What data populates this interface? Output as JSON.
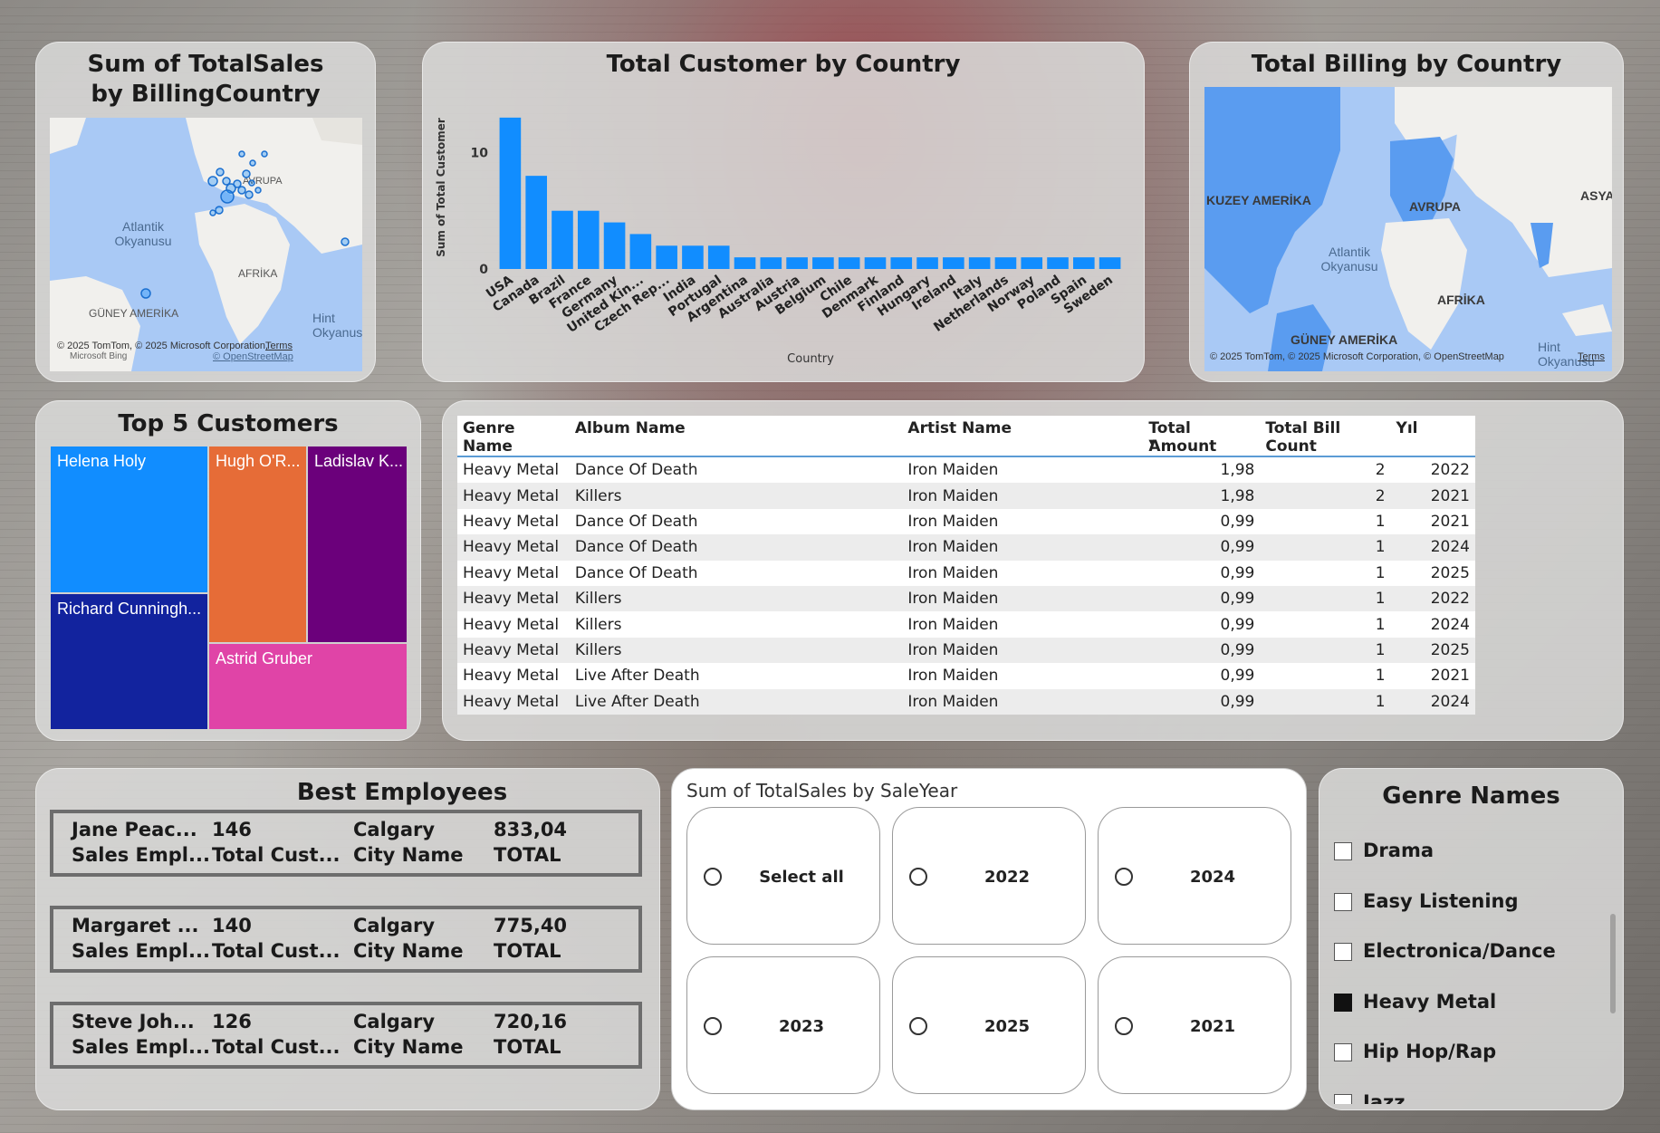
{
  "sales_map": {
    "title": "Sum of TotalSales by BillingCountry",
    "labels": [
      "AVRUPA",
      "Atlantik Okyanusu",
      "AFRİKA",
      "GÜNEY AMERİKA",
      "Hint Okyanusu"
    ],
    "attribution": "© 2025 TomTom, © 2025 Microsoft Corporation,",
    "terms": "Terms",
    "osm": "© OpenStreetMap",
    "bing": "Microsoft Bing"
  },
  "customer_chart": {
    "title": "Total Customer by Country",
    "ylabel": "Sum of Total Customer",
    "xlabel": "Country",
    "ytick_labels": [
      "0",
      "10"
    ],
    "bar_color": "#118DFF"
  },
  "chart_data": {
    "type": "bar",
    "title": "Total Customer by Country",
    "xlabel": "Country",
    "ylabel": "Sum of Total Customer",
    "categories": [
      "USA",
      "Canada",
      "Brazil",
      "France",
      "Germany",
      "United Kin...",
      "Czech Rep...",
      "India",
      "Portugal",
      "Argentina",
      "Australia",
      "Austria",
      "Belgium",
      "Chile",
      "Denmark",
      "Finland",
      "Hungary",
      "Ireland",
      "Italy",
      "Netherlands",
      "Norway",
      "Poland",
      "Spain",
      "Sweden"
    ],
    "values": [
      13,
      8,
      5,
      5,
      4,
      3,
      2,
      2,
      2,
      1,
      1,
      1,
      1,
      1,
      1,
      1,
      1,
      1,
      1,
      1,
      1,
      1,
      1,
      1
    ],
    "ylim": [
      0,
      14
    ],
    "yticks": [
      0,
      10
    ],
    "grid": false,
    "legend": "none"
  },
  "billing_map": {
    "title": "Total Billing by Country",
    "labels": [
      "KUZEY AMERİKA",
      "AVRUPA",
      "ASYA",
      "Atlantik Okyanusu",
      "AFRİKA",
      "GÜNEY AMERİKA",
      "Hint Okyanusu"
    ],
    "attribution": "© 2025 TomTom, © 2025 Microsoft Corporation, © OpenStreetMap",
    "terms": "Terms"
  },
  "top_customers": {
    "title": "Top 5 Customers",
    "items": [
      {
        "name": "Helena Holy",
        "color": "#118DFF"
      },
      {
        "name": "Hugh O'R...",
        "color": "#E66C37"
      },
      {
        "name": "Ladislav K...",
        "color": "#6B007B"
      },
      {
        "name": "Richard Cunningh...",
        "color": "#12239E"
      },
      {
        "name": "Astrid Gruber",
        "color": "#E044A7"
      }
    ]
  },
  "detail_table": {
    "columns": [
      "Genre Name",
      "Album Name",
      "Artist Name",
      "Total Amount",
      "Total Bill Count",
      "Yıl"
    ],
    "rows": [
      [
        "Heavy Metal",
        "Dance Of Death",
        "Iron Maiden",
        "1,98",
        "2",
        "2022"
      ],
      [
        "Heavy Metal",
        "Killers",
        "Iron Maiden",
        "1,98",
        "2",
        "2021"
      ],
      [
        "Heavy Metal",
        "Dance Of Death",
        "Iron Maiden",
        "0,99",
        "1",
        "2021"
      ],
      [
        "Heavy Metal",
        "Dance Of Death",
        "Iron Maiden",
        "0,99",
        "1",
        "2024"
      ],
      [
        "Heavy Metal",
        "Dance Of Death",
        "Iron Maiden",
        "0,99",
        "1",
        "2025"
      ],
      [
        "Heavy Metal",
        "Killers",
        "Iron Maiden",
        "0,99",
        "1",
        "2022"
      ],
      [
        "Heavy Metal",
        "Killers",
        "Iron Maiden",
        "0,99",
        "1",
        "2024"
      ],
      [
        "Heavy Metal",
        "Killers",
        "Iron Maiden",
        "0,99",
        "1",
        "2025"
      ],
      [
        "Heavy Metal",
        "Live After Death",
        "Iron Maiden",
        "0,99",
        "1",
        "2021"
      ],
      [
        "Heavy Metal",
        "Live After Death",
        "Iron Maiden",
        "0,99",
        "1",
        "2024"
      ]
    ]
  },
  "employees": {
    "title": "Best Employees",
    "cards": [
      {
        "name": "Jane Peac...",
        "role": "Sales Empl...",
        "count": "146",
        "count_label": "Total Cust...",
        "city": "Calgary",
        "city_label": "City Name",
        "total": "833,04",
        "total_label": "TOTAL"
      },
      {
        "name": "Margaret ...",
        "role": "Sales Empl...",
        "count": "140",
        "count_label": "Total Cust...",
        "city": "Calgary",
        "city_label": "City Name",
        "total": "775,40",
        "total_label": "TOTAL"
      },
      {
        "name": "Steve Joh...",
        "role": "Sales Empl...",
        "count": "126",
        "count_label": "Total Cust...",
        "city": "Calgary",
        "city_label": "City Name",
        "total": "720,16",
        "total_label": "TOTAL"
      }
    ]
  },
  "year_slicer": {
    "title": "Sum of TotalSales by SaleYear",
    "options": [
      "Select all",
      "2022",
      "2024",
      "2023",
      "2025",
      "2021"
    ]
  },
  "genre_slicer": {
    "title": "Genre Names",
    "items": [
      {
        "label": "Drama",
        "checked": false
      },
      {
        "label": "Easy Listening",
        "checked": false
      },
      {
        "label": "Electronica/Dance",
        "checked": false
      },
      {
        "label": "Heavy Metal",
        "checked": true
      },
      {
        "label": "Hip Hop/Rap",
        "checked": false
      },
      {
        "label": "Jazz",
        "checked": false
      }
    ]
  }
}
